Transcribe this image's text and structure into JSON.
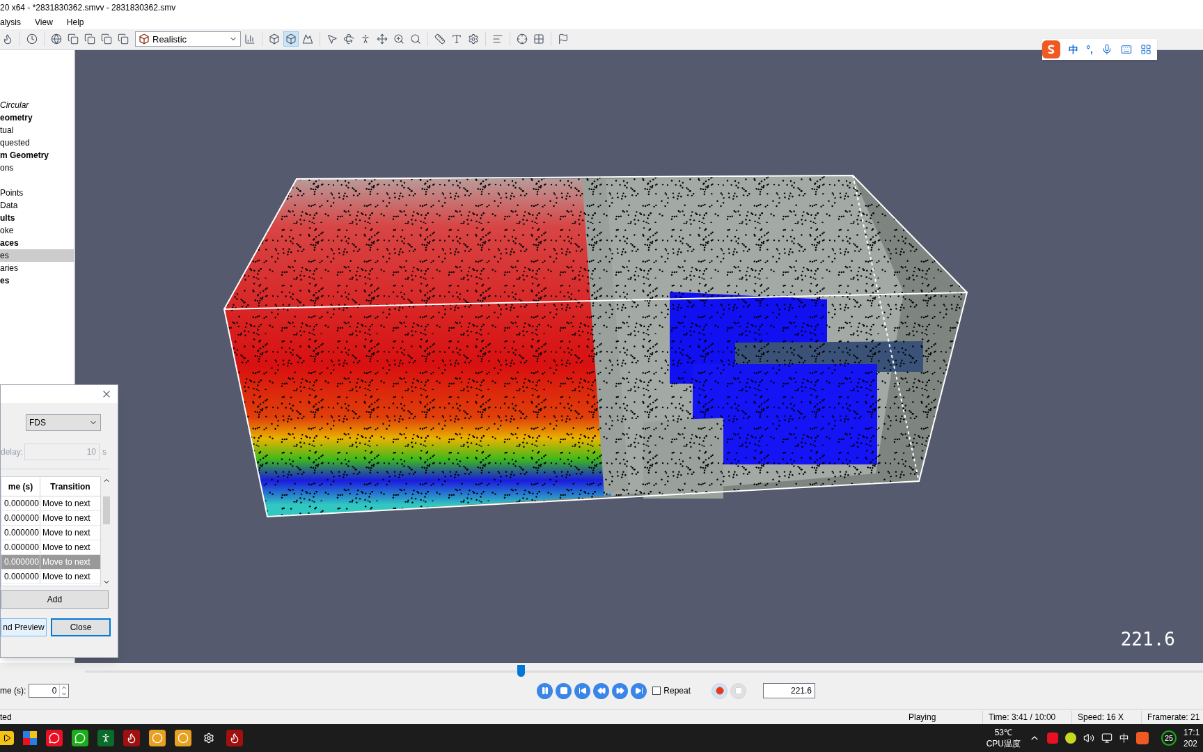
{
  "window": {
    "title": "20 x64 - *2831830362.smvv - 2831830362.smv"
  },
  "menu": [
    "alysis",
    "View",
    "Help"
  ],
  "toolbar": {
    "render_mode": "Realistic",
    "view_buttons": [
      {
        "selected": false
      },
      {
        "selected": true
      },
      {
        "selected": false
      }
    ]
  },
  "tree": {
    "groups": [
      [
        {
          "label": "Circular",
          "kind": "italic",
          "selected": false
        },
        {
          "label": "eometry",
          "kind": "bold",
          "selected": false
        },
        {
          "label": "tual",
          "kind": "plain",
          "selected": false
        },
        {
          "label": "quested",
          "kind": "plain",
          "selected": false
        },
        {
          "label": "m Geometry",
          "kind": "bold",
          "selected": false
        },
        {
          "label": "ons",
          "kind": "plain",
          "selected": false
        }
      ],
      [
        {
          "label": "Points",
          "kind": "plain",
          "selected": false
        },
        {
          "label": "Data",
          "kind": "plain",
          "selected": false
        },
        {
          "label": "ults",
          "kind": "bold",
          "selected": false
        },
        {
          "label": "oke",
          "kind": "plain",
          "selected": false
        },
        {
          "label": "aces",
          "kind": "bold",
          "selected": false
        },
        {
          "label": "es",
          "kind": "plain",
          "selected": true
        },
        {
          "label": "aries",
          "kind": "plain",
          "selected": false
        },
        {
          "label": "es",
          "kind": "bold",
          "selected": false
        }
      ]
    ]
  },
  "viewport": {
    "time_overlay": "221.6"
  },
  "dialog": {
    "format": "FDS",
    "delay_label": "delay:",
    "delay_value": "10",
    "delay_unit": "s",
    "columns": [
      "me (s)",
      "Transition"
    ],
    "rows": [
      {
        "time": "0.000000",
        "transition": "Move to next",
        "selected": false
      },
      {
        "time": "0.000000",
        "transition": "Move to next",
        "selected": false
      },
      {
        "time": "0.000000",
        "transition": "Move to next",
        "selected": false
      },
      {
        "time": "0.000000",
        "transition": "Move to next",
        "selected": false
      },
      {
        "time": "0.000000",
        "transition": "Move to next",
        "selected": true
      },
      {
        "time": "0.000000",
        "transition": "Move to next",
        "selected": false
      }
    ],
    "add_button": "Add",
    "buttons": [
      "nd Preview",
      "Close"
    ]
  },
  "playback": {
    "time_label": "me (s):",
    "time_value": "0",
    "slider": {
      "level": 0.39
    },
    "repeat": {
      "label": "Repeat",
      "checked": false
    },
    "time_field": "221.6"
  },
  "status_bar": [
    "ted",
    "Playing",
    "Time: 3:41 / 10:00",
    "Speed: 16 X",
    "Framerate: 21"
  ],
  "ime_bar": {
    "mode": "中",
    "punct": "°,"
  },
  "taskbar": {
    "temperature": "53℃",
    "sensor": "CPU温度",
    "input_mode": "中",
    "badge": "25",
    "clock_time": "17:1",
    "clock_date": "202"
  }
}
